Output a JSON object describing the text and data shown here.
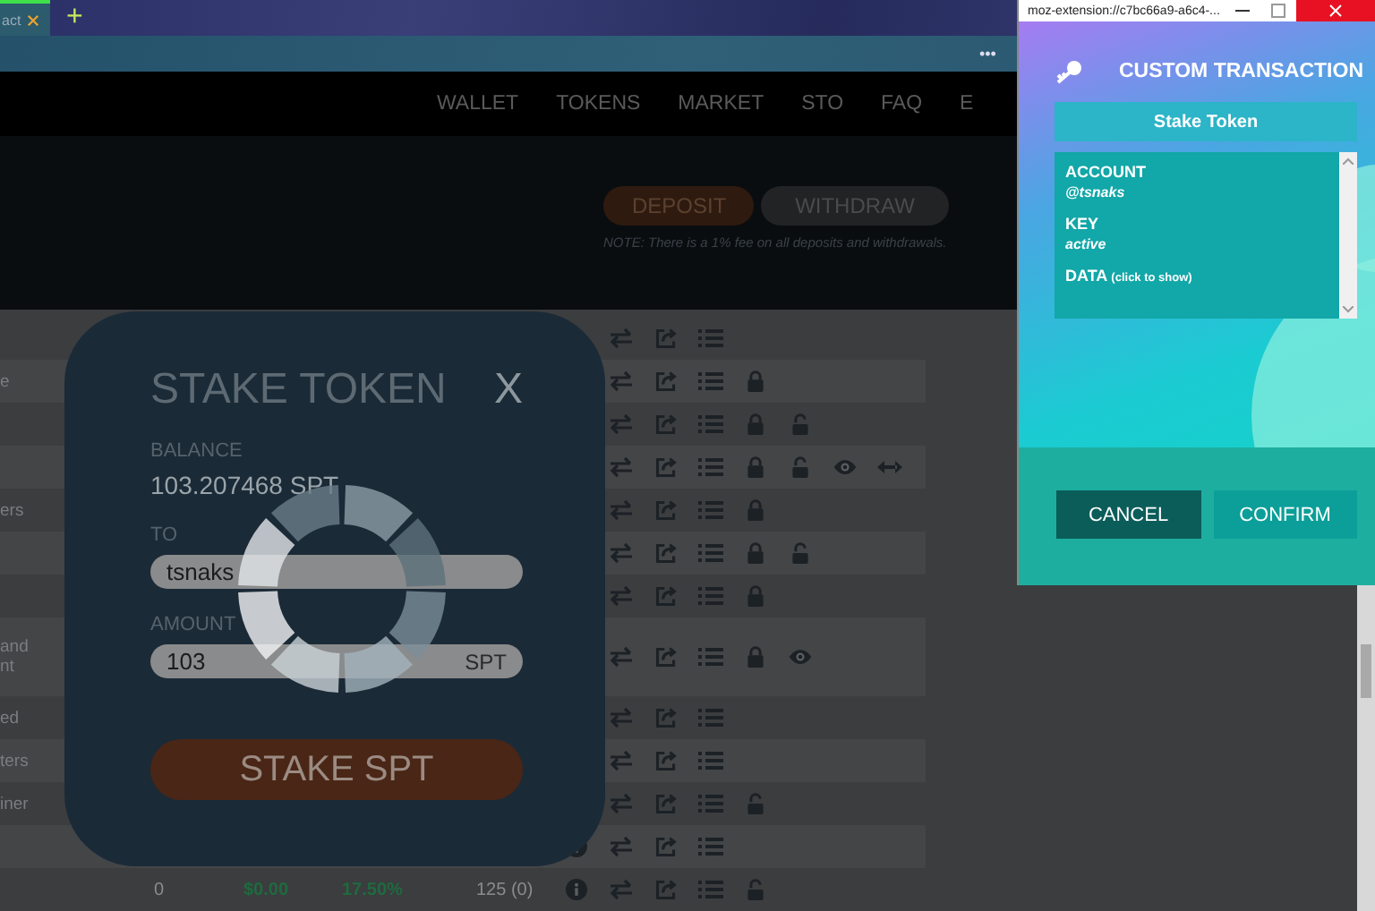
{
  "browser": {
    "tab_title": "act",
    "new_tab": "+",
    "menu": "•••"
  },
  "nav": {
    "items": [
      "WALLET",
      "TOKENS",
      "MARKET",
      "STO",
      "FAQ",
      "E"
    ]
  },
  "header": {
    "buttons": [
      {
        "label": "DEPOSIT",
        "kind": "primary"
      },
      {
        "label": "WITHDRAW",
        "kind": "secondary"
      }
    ],
    "note": "NOTE: There is a 1% fee on all deposits and withdrawals."
  },
  "table": {
    "rows": [
      {
        "actions": [
          {
            "kind": "swap"
          },
          {
            "kind": "share"
          },
          {
            "kind": "list"
          }
        ]
      },
      {
        "label": [
          "e"
        ],
        "actions": [
          {
            "kind": "swap"
          },
          {
            "kind": "share"
          },
          {
            "kind": "list"
          },
          {
            "kind": "lock"
          }
        ]
      },
      {
        "actions": [
          {
            "kind": "swap"
          },
          {
            "kind": "share"
          },
          {
            "kind": "list"
          },
          {
            "kind": "lock"
          },
          {
            "kind": "unlock"
          }
        ]
      },
      {
        "actions": [
          {
            "kind": "swap"
          },
          {
            "kind": "share"
          },
          {
            "kind": "list"
          },
          {
            "kind": "lock"
          },
          {
            "kind": "unlock"
          },
          {
            "kind": "eye"
          },
          {
            "kind": "resize"
          }
        ]
      },
      {
        "label": [
          "ers"
        ],
        "actions": [
          {
            "kind": "swap"
          },
          {
            "kind": "share"
          },
          {
            "kind": "list"
          },
          {
            "kind": "lock"
          }
        ]
      },
      {
        "actions": [
          {
            "kind": "swap"
          },
          {
            "kind": "share"
          },
          {
            "kind": "list"
          },
          {
            "kind": "lock"
          },
          {
            "kind": "unlock"
          }
        ]
      },
      {
        "actions": [
          {
            "kind": "swap"
          },
          {
            "kind": "share"
          },
          {
            "kind": "list"
          },
          {
            "kind": "lock"
          }
        ]
      },
      {
        "label": [
          "and",
          "nt"
        ],
        "tall": true,
        "actions": [
          {
            "kind": "swap"
          },
          {
            "kind": "share"
          },
          {
            "kind": "list"
          },
          {
            "kind": "lock"
          },
          {
            "kind": "eye"
          }
        ]
      },
      {
        "label": [
          "ed"
        ],
        "actions": [
          {
            "kind": "swap"
          },
          {
            "kind": "share"
          },
          {
            "kind": "list"
          }
        ]
      },
      {
        "label": [
          "ters"
        ],
        "actions": [
          {
            "kind": "swap"
          },
          {
            "kind": "share"
          },
          {
            "kind": "list"
          }
        ]
      },
      {
        "label": [
          "iner"
        ],
        "actions": [
          {
            "kind": "swap"
          },
          {
            "kind": "share"
          },
          {
            "kind": "list"
          },
          {
            "kind": "unlock"
          }
        ]
      },
      {
        "info": true,
        "actions": [
          {
            "kind": "swap"
          },
          {
            "kind": "share"
          },
          {
            "kind": "list"
          }
        ]
      },
      {
        "cells": [
          "0",
          "$0.00",
          "17.50%",
          "125 (0)"
        ],
        "info": true,
        "actions": [
          {
            "kind": "swap"
          },
          {
            "kind": "share"
          },
          {
            "kind": "list"
          },
          {
            "kind": "unlock"
          }
        ]
      }
    ]
  },
  "modal": {
    "title": "STAKE TOKEN",
    "close": "X",
    "balance_label": "BALANCE",
    "balance": "103.207468 SPT",
    "to_label": "TO",
    "to_value": "tsnaks",
    "amount_label": "AMOUNT",
    "amount_value": "103",
    "amount_unit": "SPT",
    "submit": "STAKE SPT"
  },
  "popup": {
    "url": "moz-extension://c7bc66a9-a6c4-...",
    "title": "CUSTOM TRANSACTION",
    "operation": "Stake Token",
    "fields": [
      {
        "label": "ACCOUNT",
        "value": "@tsnaks"
      },
      {
        "label": "KEY",
        "value": "active"
      },
      {
        "label": "DATA",
        "hint": "(click to show)"
      }
    ],
    "buttons": [
      {
        "label": "CANCEL",
        "kind": "cancel"
      },
      {
        "label": "CONFIRM",
        "kind": "confirm"
      }
    ]
  }
}
